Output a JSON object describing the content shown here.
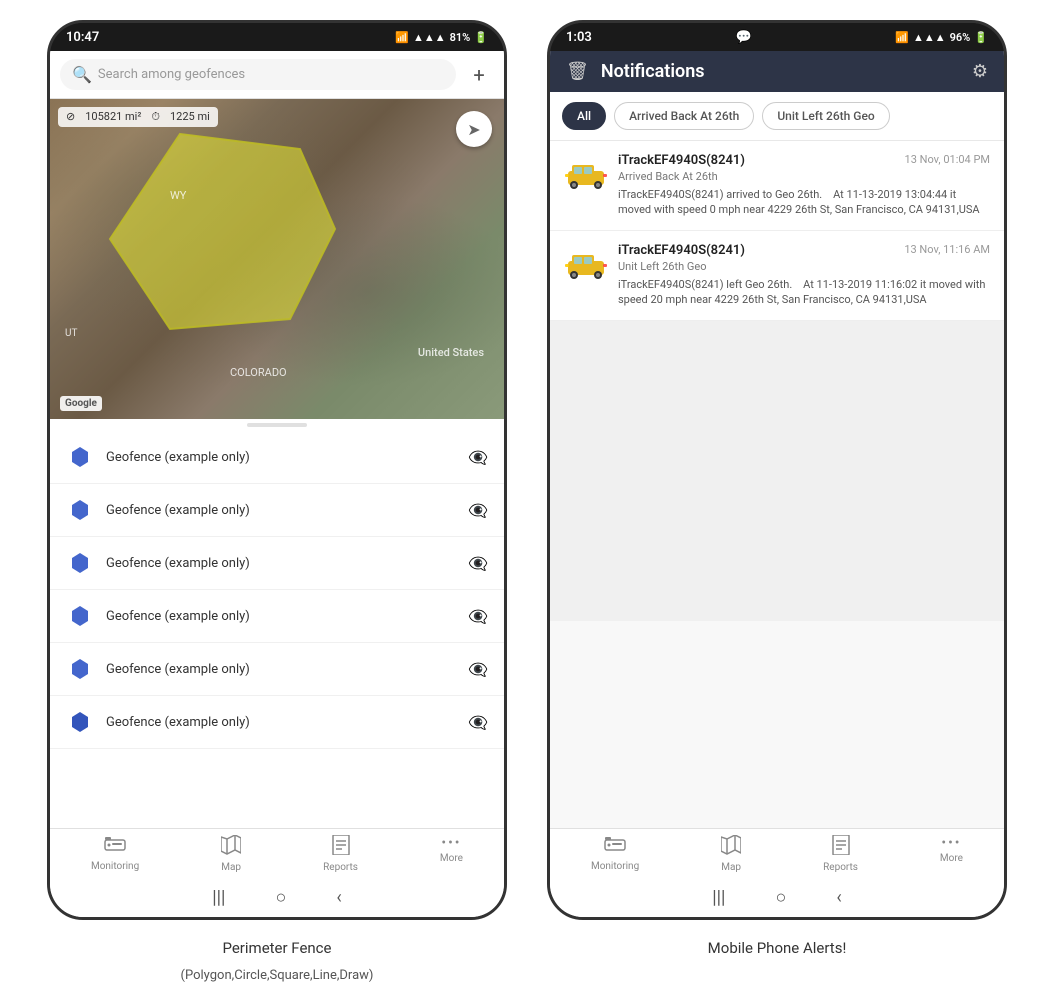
{
  "left_phone": {
    "status_bar": {
      "time": "10:47",
      "signal": "WiFi",
      "bars": "●●●",
      "battery": "81%"
    },
    "search": {
      "placeholder": "Search among geofences"
    },
    "map": {
      "area_label": "105821 mi²",
      "distance_label": "1225 mi",
      "label_us": "United States",
      "label_wy": "WY",
      "label_colorado": "COLORADO",
      "label_ut": "UT"
    },
    "geofences": [
      {
        "name": "Geofence (example only)"
      },
      {
        "name": "Geofence (example only)"
      },
      {
        "name": "Geofence (example only)"
      },
      {
        "name": "Geofence (example only)"
      },
      {
        "name": "Geofence (example only)"
      },
      {
        "name": "Geofence (example only)"
      }
    ],
    "nav": {
      "items": [
        {
          "label": "Monitoring",
          "icon": "🚌"
        },
        {
          "label": "Map",
          "icon": "🗺"
        },
        {
          "label": "Reports",
          "icon": "📊"
        },
        {
          "label": "More",
          "icon": "•••"
        }
      ]
    },
    "caption": "Perimeter Fence",
    "caption_sub": "(Polygon,Circle,Square,Line,Draw)"
  },
  "right_phone": {
    "status_bar": {
      "time": "1:03",
      "chat_icon": "💬",
      "battery": "96%"
    },
    "header": {
      "title": "Notifications",
      "trash_icon": "trash",
      "settings_icon": "settings"
    },
    "filters": [
      {
        "label": "All",
        "active": true
      },
      {
        "label": "Arrived Back At 26th",
        "active": false
      },
      {
        "label": "Unit Left 26th Geo",
        "active": false
      }
    ],
    "notifications": [
      {
        "device": "iTrackEF4940S(8241)",
        "time": "13 Nov, 01:04 PM",
        "subtitle": "Arrived Back At 26th",
        "text": "iTrackEF4940S(8241) arrived to Geo 26th.    At 11-13-2019 13:04:44 it moved with speed 0 mph near 4229 26th St, San Francisco, CA 94131,USA"
      },
      {
        "device": "iTrackEF4940S(8241)",
        "time": "13 Nov, 11:16 AM",
        "subtitle": "Unit Left 26th Geo",
        "text": "iTrackEF4940S(8241) left Geo 26th.    At 11-13-2019 11:16:02 it moved with speed 20 mph near 4229 26th St, San Francisco, CA 94131,USA"
      }
    ],
    "nav": {
      "items": [
        {
          "label": "Monitoring",
          "icon": "🚌"
        },
        {
          "label": "Map",
          "icon": "🗺"
        },
        {
          "label": "Reports",
          "icon": "📊"
        },
        {
          "label": "More",
          "icon": "•••"
        }
      ]
    },
    "caption": "Mobile Phone Alerts!"
  }
}
